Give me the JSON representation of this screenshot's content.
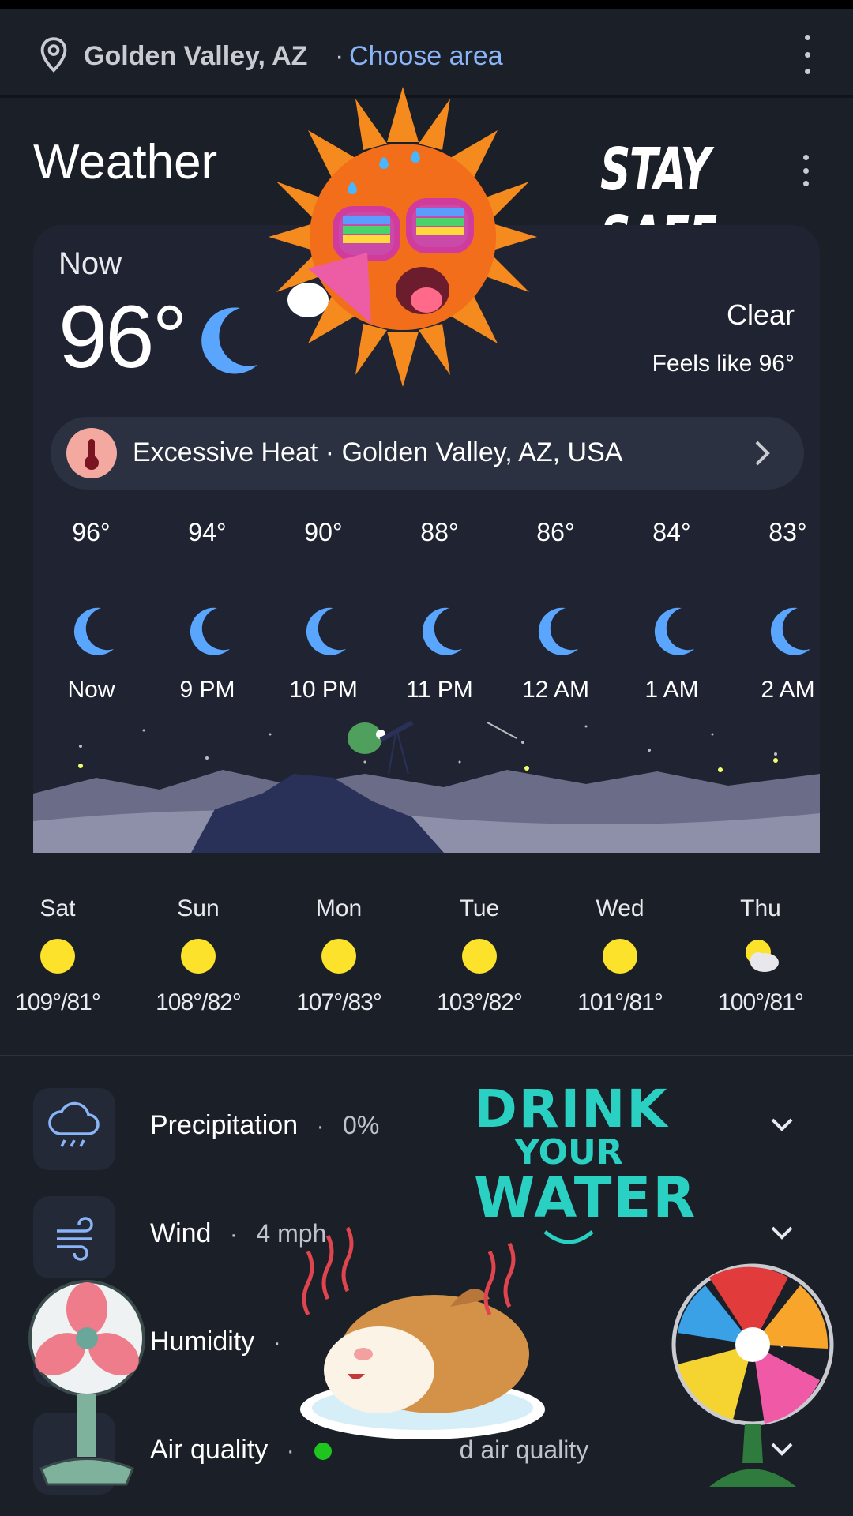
{
  "location": {
    "name": "Golden Valley, AZ",
    "separator": "·",
    "choose_area": "Choose area"
  },
  "header": {
    "title": "Weather"
  },
  "current": {
    "label": "Now",
    "temp": "96°",
    "condition": "Clear",
    "feels_like": "Feels like 96°"
  },
  "alert": {
    "title": "Excessive Heat",
    "separator": "·",
    "place": "Golden Valley, AZ, USA"
  },
  "hourly": [
    {
      "temp": "96°",
      "time": "Now"
    },
    {
      "temp": "94°",
      "time": "9 PM"
    },
    {
      "temp": "90°",
      "time": "10 PM"
    },
    {
      "temp": "88°",
      "time": "11 PM"
    },
    {
      "temp": "86°",
      "time": "12 AM"
    },
    {
      "temp": "84°",
      "time": "1 AM"
    },
    {
      "temp": "83°",
      "time": "2 AM"
    }
  ],
  "daily": [
    {
      "day": "Sat",
      "range": "109°/81°",
      "icon": "sun-icon"
    },
    {
      "day": "Sun",
      "range": "108°/82°",
      "icon": "sun-icon"
    },
    {
      "day": "Mon",
      "range": "107°/83°",
      "icon": "sun-icon"
    },
    {
      "day": "Tue",
      "range": "103°/82°",
      "icon": "sun-icon"
    },
    {
      "day": "Wed",
      "range": "101°/81°",
      "icon": "sun-icon"
    },
    {
      "day": "Thu",
      "range": "100°/81°",
      "icon": "partly-cloudy-icon"
    }
  ],
  "details": {
    "precipitation": {
      "label": "Precipitation",
      "sep": "·",
      "value": "0%"
    },
    "wind": {
      "label": "Wind",
      "sep": "·",
      "value": "4 mph"
    },
    "humidity": {
      "label": "Humidity",
      "sep": "·"
    },
    "air_quality": {
      "label": "Air quality",
      "sep": "·",
      "value": "d air quality"
    }
  },
  "stickers": {
    "stay_safe": "STAY SAFE",
    "drink_1": "DRINK",
    "drink_2": "YOUR",
    "drink_3": "WATER"
  },
  "colors": {
    "background": "#1b1f27",
    "card": "#202432",
    "accent_link": "#8ab4f8",
    "moon": "#5aa6ff",
    "sun": "#fde22b",
    "alert_icon_bg": "#f4a9a0",
    "aq_good": "#1ec51e",
    "water_text": "#2ad1c2"
  }
}
